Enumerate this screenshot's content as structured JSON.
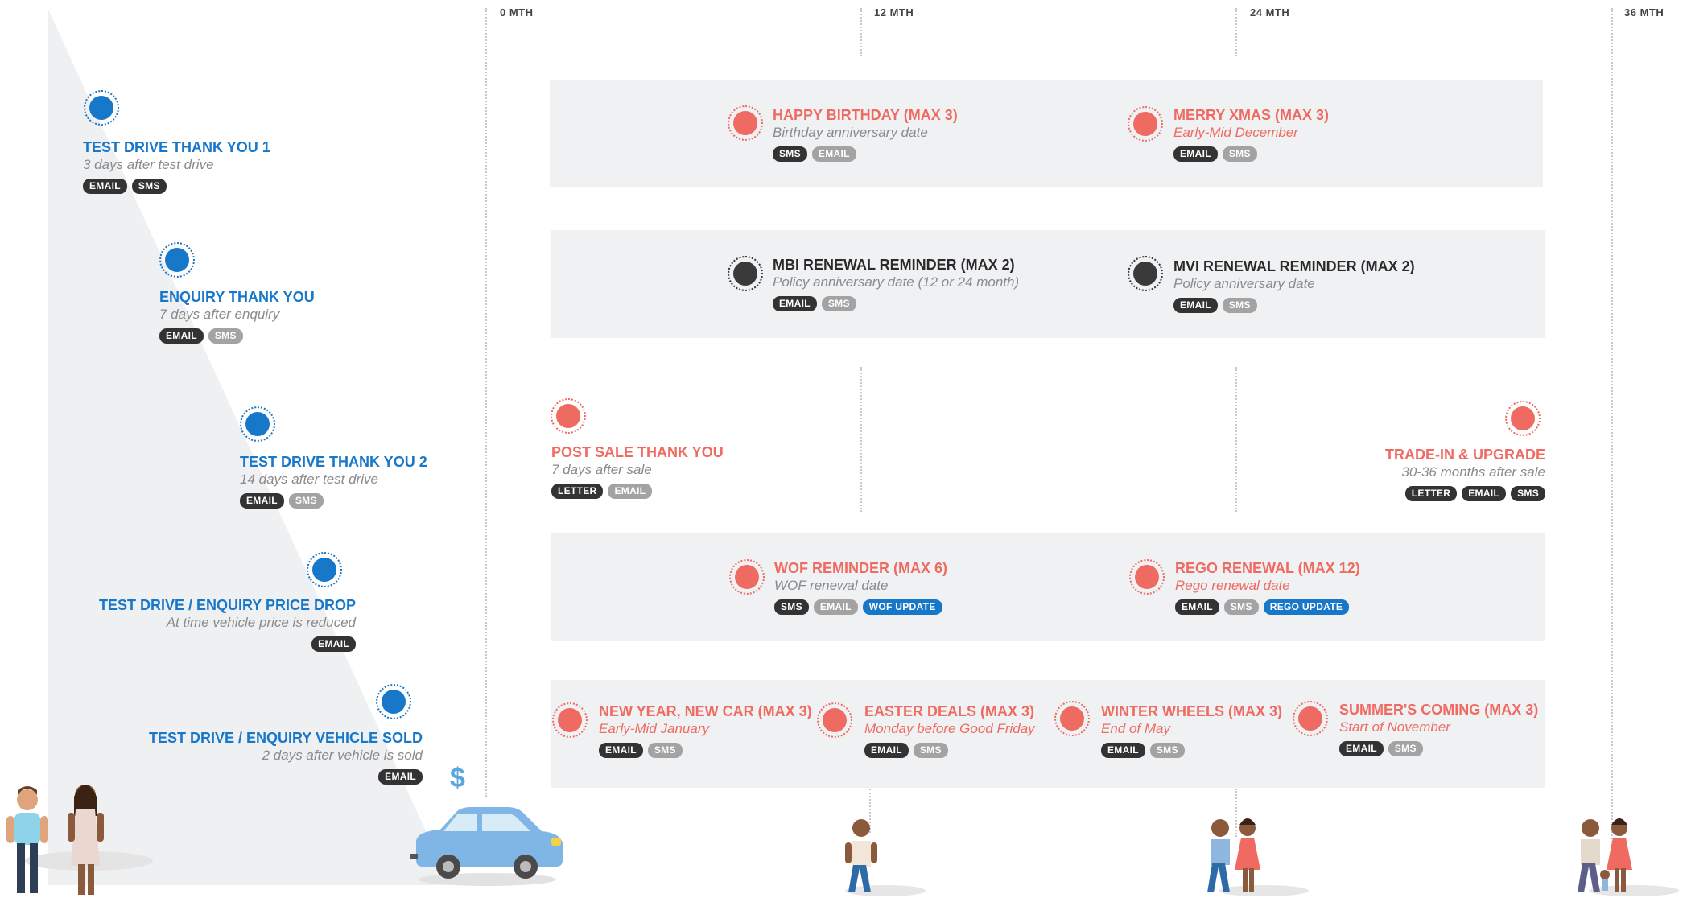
{
  "timeline": {
    "months": [
      "0 MTH",
      "12 MTH",
      "24 MTH",
      "36 MTH"
    ]
  },
  "pre_sale": [
    {
      "title": "TEST DRIVE THANK YOU 1",
      "sub": "3 days after test drive",
      "tags": [
        "EMAIL",
        "SMS"
      ]
    },
    {
      "title": "ENQUIRY THANK YOU",
      "sub": "7 days after enquiry",
      "tags": [
        "EMAIL",
        "SMS"
      ]
    },
    {
      "title": "TEST DRIVE THANK YOU 2",
      "sub": "14 days after test drive",
      "tags": [
        "EMAIL",
        "SMS"
      ]
    },
    {
      "title": "TEST DRIVE / ENQUIRY PRICE DROP",
      "sub": "At time vehicle price is reduced",
      "tags": [
        "EMAIL"
      ]
    },
    {
      "title": "TEST DRIVE / ENQUIRY VEHICLE SOLD",
      "sub": "2 days after vehicle is sold",
      "tags": [
        "EMAIL"
      ]
    }
  ],
  "row1": [
    {
      "title": "HAPPY BIRTHDAY (MAX 3)",
      "sub": "Birthday anniversary date",
      "tags": [
        "SMS",
        "EMAIL"
      ]
    },
    {
      "title": "MERRY XMAS (MAX 3)",
      "sub": "Early-Mid December",
      "tags": [
        "EMAIL",
        "SMS"
      ]
    }
  ],
  "row2": [
    {
      "title": "MBI RENEWAL REMINDER (MAX 2)",
      "sub": "Policy anniversary date (12 or 24 month)",
      "tags": [
        "EMAIL",
        "SMS"
      ]
    },
    {
      "title": "MVI RENEWAL REMINDER (MAX 2)",
      "sub": "Policy anniversary date",
      "tags": [
        "EMAIL",
        "SMS"
      ]
    }
  ],
  "row3": [
    {
      "title": "POST SALE THANK YOU",
      "sub": "7 days after sale",
      "tags": [
        "LETTER",
        "EMAIL"
      ]
    },
    {
      "title": "TRADE-IN & UPGRADE",
      "sub": "30-36 months after sale",
      "tags": [
        "LETTER",
        "EMAIL",
        "SMS"
      ]
    }
  ],
  "row4": [
    {
      "title": "WOF REMINDER (MAX 6)",
      "sub": "WOF renewal date",
      "tags": [
        "SMS",
        "EMAIL",
        "WOF UPDATE"
      ]
    },
    {
      "title": "REGO RENEWAL (MAX 12)",
      "sub": "Rego renewal date",
      "tags": [
        "EMAIL",
        "SMS",
        "REGO UPDATE"
      ]
    }
  ],
  "row5": [
    {
      "title": "NEW YEAR, NEW CAR (MAX 3)",
      "sub": "Early-Mid January",
      "tags": [
        "EMAIL",
        "SMS"
      ]
    },
    {
      "title": "EASTER DEALS (MAX 3)",
      "sub": "Monday before Good Friday",
      "tags": [
        "EMAIL",
        "SMS"
      ]
    },
    {
      "title": "WINTER WHEELS (MAX 3)",
      "sub": "End of May",
      "tags": [
        "EMAIL",
        "SMS"
      ]
    },
    {
      "title": "SUMMER'S COMING (MAX 3)",
      "sub": "Start of November",
      "tags": [
        "EMAIL",
        "SMS"
      ]
    }
  ],
  "dollar_sign": "$",
  "colors": {
    "blue": "#1777c8",
    "red": "#ef6b62",
    "dark": "#333333",
    "band": "#f0f1f3"
  }
}
